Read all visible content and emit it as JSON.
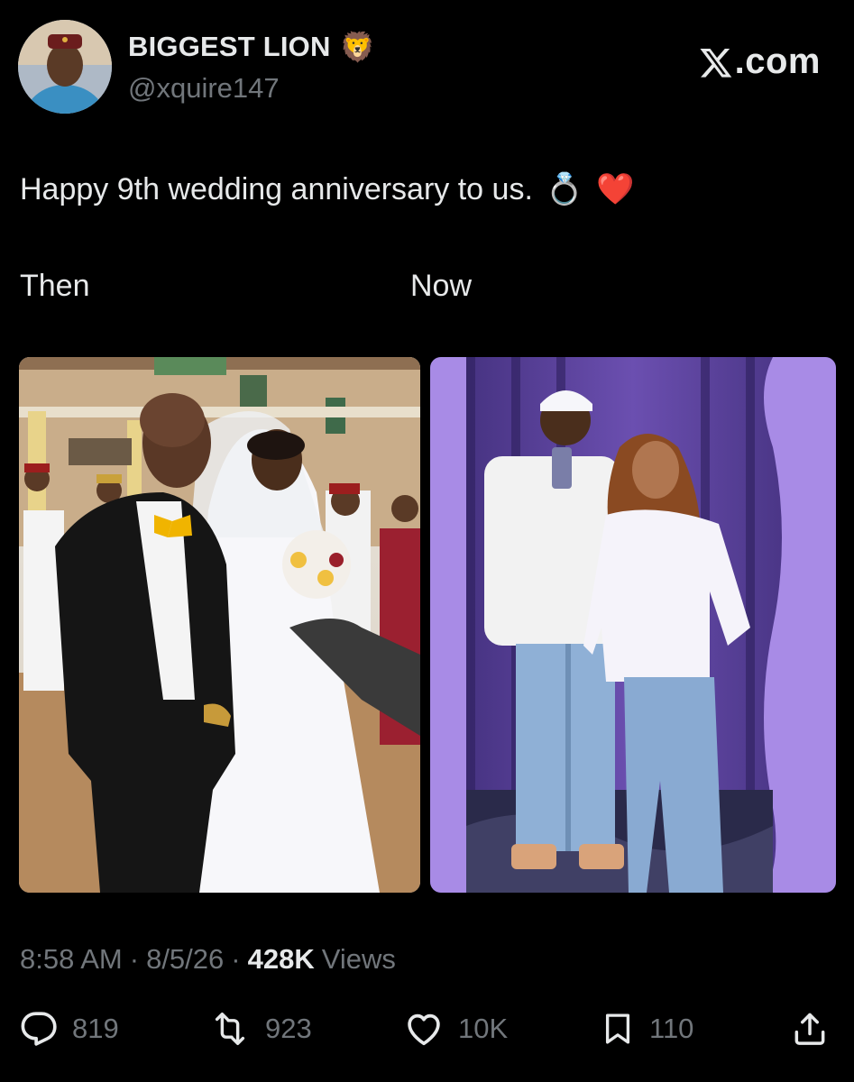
{
  "author": {
    "display_name": "BIGGEST LION",
    "name_emoji": "🦁",
    "handle": "@xquire147"
  },
  "brand": {
    "label": ".com",
    "icon": "x-logo-icon"
  },
  "tweet": {
    "text": "Happy 9th wedding anniversary to us.",
    "emojis": [
      "💍",
      "❤️"
    ],
    "label_left": "Then",
    "label_right": "Now"
  },
  "media": [
    {
      "name": "then-photo",
      "icon": "wedding-photo"
    },
    {
      "name": "now-photo",
      "icon": "couple-photo"
    }
  ],
  "meta": {
    "time": "8:58 AM",
    "separator": "·",
    "date": "8/5/26",
    "views_count": "428K",
    "views_label": "Views"
  },
  "actions": {
    "reply": {
      "icon": "reply-icon",
      "count": "819"
    },
    "repost": {
      "icon": "repost-icon",
      "count": "923"
    },
    "like": {
      "icon": "heart-icon",
      "count": "10K"
    },
    "bookmark": {
      "icon": "bookmark-icon",
      "count": "110"
    },
    "share": {
      "icon": "share-icon"
    }
  },
  "colors": {
    "background": "#000000",
    "text": "#e7e9ea",
    "secondary": "#71767b",
    "now_photo_tint": "#6b4fb0"
  }
}
